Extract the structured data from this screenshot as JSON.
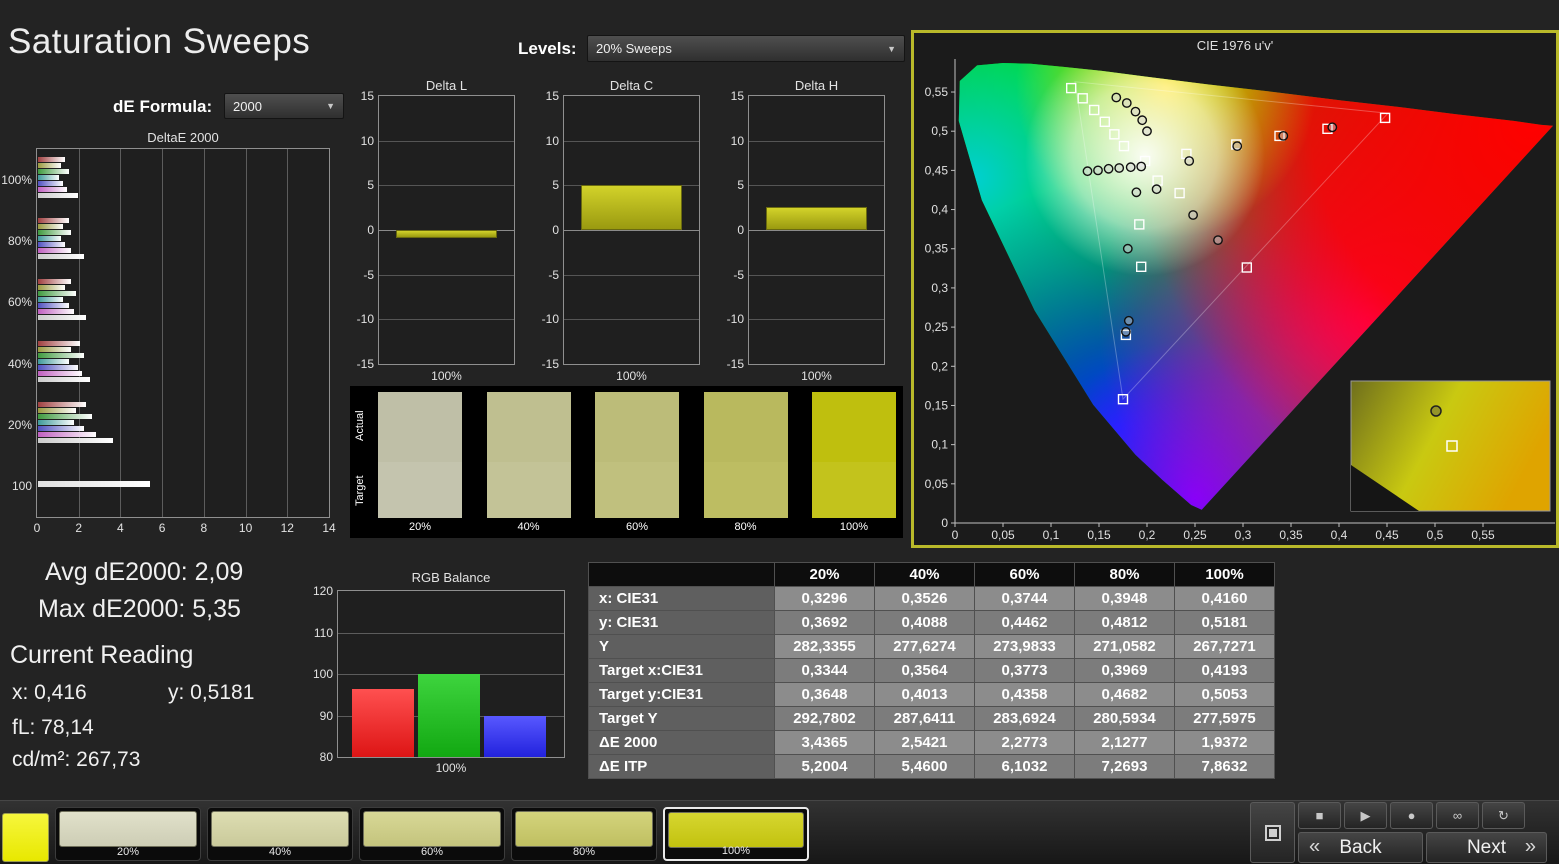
{
  "header": {
    "title": "Saturation Sweeps",
    "levels_label": "Levels:",
    "levels_value": "20% Sweeps",
    "de_formula_label": "dE Formula:",
    "de_formula_value": "2000"
  },
  "stats": {
    "avg": "Avg dE2000: 2,09",
    "max": "Max dE2000: 5,35",
    "current_reading_label": "Current Reading",
    "x": "x: 0,416",
    "y": "y: 0,5181",
    "fl": "fL: 78,14",
    "cdm2": "cd/m²: 267,73"
  },
  "icons": {
    "caret_down": "▼",
    "back_chevron": "«",
    "next_chevron": "»"
  },
  "chart_data": {
    "deltae_2000": {
      "type": "bar",
      "orientation": "horizontal",
      "title": "DeltaE 2000",
      "xlim": [
        0,
        14
      ],
      "x_ticks": [
        "0",
        "2",
        "4",
        "6",
        "8",
        "10",
        "12",
        "14"
      ],
      "bar_colors": [
        "#a04040",
        "#9a9a40",
        "#3f9a3f",
        "#3f9a9a",
        "#5050c0",
        "#c060c0",
        "#cccccc"
      ],
      "groups": [
        {
          "label": "100%",
          "values": [
            1.3,
            1.1,
            1.5,
            1.0,
            1.2,
            1.4,
            1.9
          ]
        },
        {
          "label": "80%",
          "values": [
            1.5,
            1.2,
            1.6,
            1.1,
            1.3,
            1.6,
            2.2
          ]
        },
        {
          "label": "60%",
          "values": [
            1.6,
            1.3,
            1.8,
            1.2,
            1.5,
            1.7,
            2.3
          ]
        },
        {
          "label": "40%",
          "values": [
            2.0,
            1.6,
            2.2,
            1.5,
            1.9,
            2.1,
            2.5
          ]
        },
        {
          "label": "20%",
          "values": [
            2.3,
            1.8,
            2.6,
            1.7,
            2.2,
            2.8,
            3.6
          ]
        },
        {
          "label": "100",
          "values": [
            5.35
          ]
        }
      ]
    },
    "delta_l": {
      "type": "bar",
      "title": "Delta L",
      "ylim": [
        -15,
        15
      ],
      "y_ticks": [
        "15",
        "10",
        "5",
        "0",
        "-5",
        "-10",
        "-15"
      ],
      "categories": [
        "100%"
      ],
      "values": [
        -0.9
      ]
    },
    "delta_c": {
      "type": "bar",
      "title": "Delta C",
      "ylim": [
        -15,
        15
      ],
      "y_ticks": [
        "15",
        "10",
        "5",
        "0",
        "-5",
        "-10",
        "-15"
      ],
      "categories": [
        "100%"
      ],
      "values": [
        5.0
      ]
    },
    "delta_h": {
      "type": "bar",
      "title": "Delta H",
      "ylim": [
        -15,
        15
      ],
      "y_ticks": [
        "15",
        "10",
        "5",
        "0",
        "-5",
        "-10",
        "-15"
      ],
      "categories": [
        "100%"
      ],
      "values": [
        2.6
      ]
    },
    "rgb_balance": {
      "type": "bar",
      "title": "RGB Balance",
      "ylim": [
        80,
        120
      ],
      "y_ticks": [
        "120",
        "110",
        "100",
        "90",
        "80"
      ],
      "categories": [
        "100%"
      ],
      "series": [
        {
          "name": "red",
          "color_top": "#ff5050",
          "color_bottom": "#dd1515",
          "value": 96.5
        },
        {
          "name": "green",
          "color_top": "#3ed43e",
          "color_bottom": "#12a812",
          "value": 100
        },
        {
          "name": "blue",
          "color_top": "#5858ff",
          "color_bottom": "#2222dd",
          "value": 90
        }
      ]
    },
    "cie": {
      "type": "scatter",
      "title": "CIE 1976 u'v'",
      "xlim": [
        0,
        0.6
      ],
      "ylim": [
        0,
        0.6
      ],
      "x_ticks": [
        "0",
        "0,05",
        "0,1",
        "0,15",
        "0,2",
        "0,25",
        "0,3",
        "0,35",
        "0,4",
        "0,45",
        "0,5",
        "0,55"
      ],
      "y_ticks": [
        "0",
        "0,05",
        "0,1",
        "0,15",
        "0,2",
        "0,25",
        "0,3",
        "0,35",
        "0,4",
        "0,45",
        "0,5",
        "0,55"
      ],
      "locus": [
        [
          0.257,
          0.017
        ],
        [
          0.246,
          0.023
        ],
        [
          0.216,
          0.055
        ],
        [
          0.188,
          0.087
        ],
        [
          0.144,
          0.151
        ],
        [
          0.083,
          0.271
        ],
        [
          0.028,
          0.412
        ],
        [
          0.004,
          0.513
        ],
        [
          0.005,
          0.564
        ],
        [
          0.023,
          0.584
        ],
        [
          0.05,
          0.587
        ],
        [
          0.079,
          0.586
        ],
        [
          0.113,
          0.582
        ],
        [
          0.153,
          0.577
        ],
        [
          0.203,
          0.569
        ],
        [
          0.262,
          0.56
        ],
        [
          0.332,
          0.55
        ],
        [
          0.404,
          0.539
        ],
        [
          0.469,
          0.53
        ],
        [
          0.52,
          0.522
        ],
        [
          0.583,
          0.513
        ],
        [
          0.611,
          0.508
        ],
        [
          0.623,
          0.507
        ]
      ],
      "gamut_triangle": [
        [
          0.451,
          0.523
        ],
        [
          0.125,
          0.563
        ],
        [
          0.175,
          0.158
        ]
      ],
      "targets": [
        [
          0.121,
          0.555
        ],
        [
          0.133,
          0.542
        ],
        [
          0.145,
          0.527
        ],
        [
          0.156,
          0.512
        ],
        [
          0.166,
          0.496
        ],
        [
          0.176,
          0.481
        ],
        [
          0.198,
          0.462
        ],
        [
          0.241,
          0.471
        ],
        [
          0.293,
          0.483
        ],
        [
          0.338,
          0.494
        ],
        [
          0.388,
          0.503
        ],
        [
          0.448,
          0.517
        ],
        [
          0.211,
          0.437
        ],
        [
          0.234,
          0.421
        ],
        [
          0.192,
          0.381
        ],
        [
          0.194,
          0.327
        ],
        [
          0.178,
          0.24
        ],
        [
          0.175,
          0.158
        ],
        [
          0.304,
          0.326
        ]
      ],
      "measured": [
        [
          0.168,
          0.543
        ],
        [
          0.179,
          0.536
        ],
        [
          0.188,
          0.525
        ],
        [
          0.195,
          0.514
        ],
        [
          0.2,
          0.5
        ],
        [
          0.138,
          0.449
        ],
        [
          0.149,
          0.45
        ],
        [
          0.16,
          0.452
        ],
        [
          0.171,
          0.453
        ],
        [
          0.183,
          0.454
        ],
        [
          0.194,
          0.455
        ],
        [
          0.244,
          0.462
        ],
        [
          0.294,
          0.481
        ],
        [
          0.342,
          0.494
        ],
        [
          0.393,
          0.505
        ],
        [
          0.21,
          0.426
        ],
        [
          0.189,
          0.422
        ],
        [
          0.248,
          0.393
        ],
        [
          0.274,
          0.361
        ],
        [
          0.18,
          0.35
        ],
        [
          0.181,
          0.258
        ],
        [
          0.178,
          0.244
        ]
      ],
      "inset": {
        "circle_offset": [
          85,
          30
        ],
        "square_offset": [
          96,
          60
        ]
      }
    },
    "swatch_strip": {
      "row_labels": [
        "Actual",
        "Target"
      ],
      "columns": [
        {
          "label": "20%",
          "actual": "#bfbfa7",
          "target": "#c4c4ae"
        },
        {
          "label": "40%",
          "actual": "#bfbf90",
          "target": "#c3c397"
        },
        {
          "label": "60%",
          "actual": "#bcbc79",
          "target": "#c0c07e"
        },
        {
          "label": "80%",
          "actual": "#b9b95e",
          "target": "#bdbd62"
        },
        {
          "label": "100%",
          "actual": "#bfbf0e",
          "target": "#c3c31c"
        }
      ]
    },
    "table": {
      "headers": [
        "",
        "20%",
        "40%",
        "60%",
        "80%",
        "100%"
      ],
      "rows": [
        {
          "label": "x: CIE31",
          "values": [
            "0,3296",
            "0,3526",
            "0,3744",
            "0,3948",
            "0,4160"
          ]
        },
        {
          "label": "y: CIE31",
          "values": [
            "0,3692",
            "0,4088",
            "0,4462",
            "0,4812",
            "0,5181"
          ]
        },
        {
          "label": "Y",
          "values": [
            "282,3355",
            "277,6274",
            "273,9833",
            "271,0582",
            "267,7271"
          ]
        },
        {
          "label": "Target x:CIE31",
          "values": [
            "0,3344",
            "0,3564",
            "0,3773",
            "0,3969",
            "0,4193"
          ]
        },
        {
          "label": "Target y:CIE31",
          "values": [
            "0,3648",
            "0,4013",
            "0,4358",
            "0,4682",
            "0,5053"
          ]
        },
        {
          "label": "Target Y",
          "values": [
            "292,7802",
            "287,6411",
            "283,6924",
            "280,5934",
            "277,5975"
          ]
        },
        {
          "label": "ΔE 2000",
          "values": [
            "3,4365",
            "2,5421",
            "2,2773",
            "2,1277",
            "1,9372"
          ]
        },
        {
          "label": "ΔE ITP",
          "values": [
            "5,2004",
            "5,4600",
            "6,1032",
            "7,2693",
            "7,8632"
          ]
        }
      ]
    }
  },
  "bottom_bar": {
    "current_patch_color": "#f6f63c",
    "selected_index": 4,
    "patches": [
      {
        "label": "20%",
        "color": "#dcdcc2"
      },
      {
        "label": "40%",
        "color": "#d8d8a6"
      },
      {
        "label": "60%",
        "color": "#d2d286"
      },
      {
        "label": "80%",
        "color": "#cdcd68"
      },
      {
        "label": "100%",
        "color": "#d0d010"
      }
    ],
    "media_buttons": [
      {
        "name": "stop",
        "glyph": "■"
      },
      {
        "name": "play",
        "glyph": "▶"
      },
      {
        "name": "record",
        "glyph": "●"
      },
      {
        "name": "loop",
        "glyph": "∞"
      },
      {
        "name": "refresh",
        "glyph": "↻"
      }
    ],
    "back_label": "Back",
    "next_label": "Next"
  }
}
